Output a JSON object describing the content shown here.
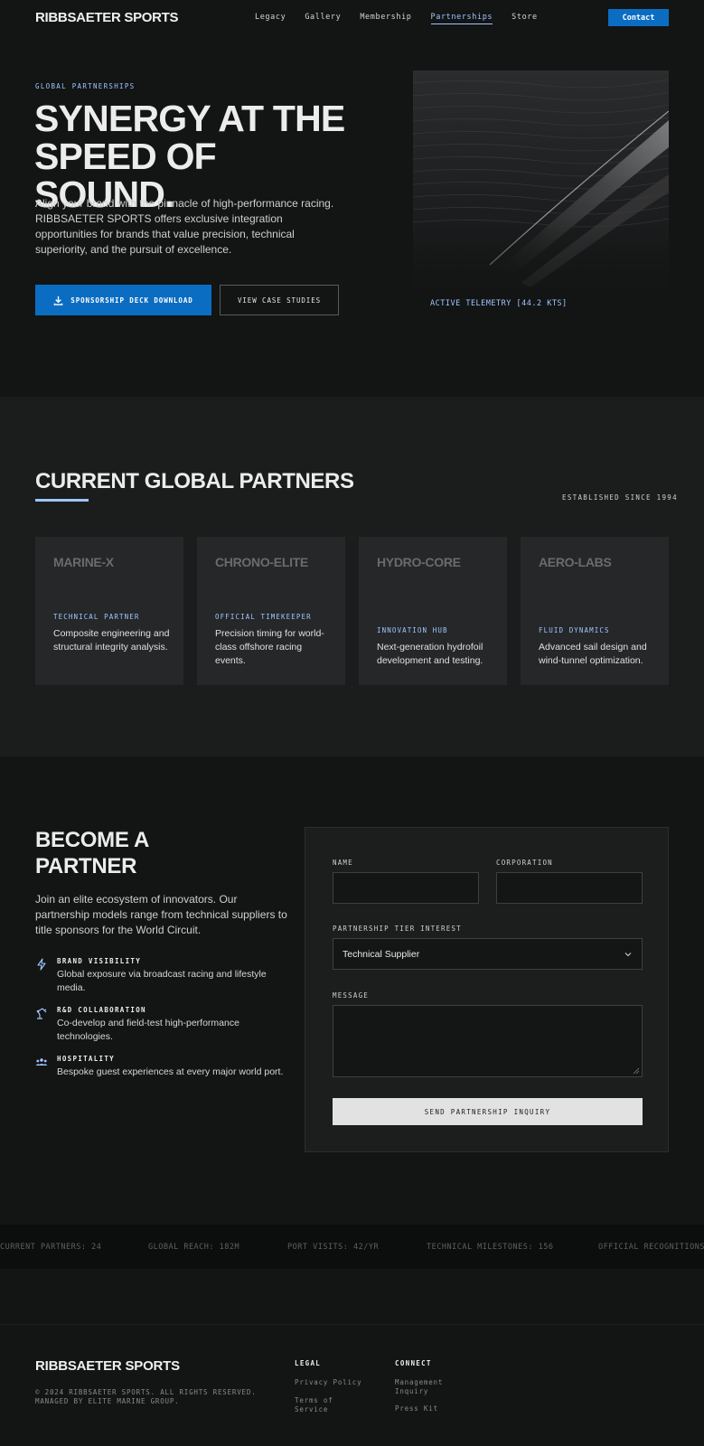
{
  "brand": "RIBBSAETER SPORTS",
  "nav": {
    "links": [
      "Legacy",
      "Gallery",
      "Membership",
      "Partnerships",
      "Store"
    ],
    "contact": "Contact"
  },
  "hero": {
    "eyebrow": "GLOBAL PARTNERSHIPS",
    "title": "SYNERGY AT THE SPEED OF SOUND.",
    "description": "Align your brand with the pinnacle of high-performance racing. RIBBSAETER SPORTS offers exclusive integration opportunities for brands that value precision, technical superiority, and the pursuit of excellence.",
    "primary_button": "SPONSORSHIP DECK DOWNLOAD",
    "secondary_button": "VIEW CASE STUDIES",
    "telemetry": "ACTIVE TELEMETRY [44.2 KTS]"
  },
  "partners": {
    "title": "CURRENT GLOBAL PARTNERS",
    "established": "ESTABLISHED SINCE 1994",
    "cards": [
      {
        "name": "MARINE-X",
        "role": "TECHNICAL PARTNER",
        "desc": "Composite engineering and structural integrity analysis."
      },
      {
        "name": "CHRONO-ELITE",
        "role": "OFFICIAL TIMEKEEPER",
        "desc": "Precision timing for world-class offshore racing events."
      },
      {
        "name": "HYDRO-CORE",
        "role": "INNOVATION HUB",
        "desc": "Next-generation hydrofoil development and testing."
      },
      {
        "name": "AERO-LABS",
        "role": "FLUID DYNAMICS",
        "desc": "Advanced sail design and wind-tunnel optimization."
      }
    ]
  },
  "become": {
    "title": "BECOME A PARTNER",
    "description": "Join an elite ecosystem of innovators. Our partnership models range from technical suppliers to title sponsors for the World Circuit.",
    "benefits": [
      {
        "icon": "lightning-icon",
        "title": "BRAND VISIBILITY",
        "desc": "Global exposure via broadcast racing and lifestyle media."
      },
      {
        "icon": "robot-arm-icon",
        "title": "R&D COLLABORATION",
        "desc": "Co-develop and field-test high-performance technologies."
      },
      {
        "icon": "group-icon",
        "title": "HOSPITALITY",
        "desc": "Bespoke guest experiences at every major world port."
      }
    ]
  },
  "form": {
    "name_label": "NAME",
    "name_value": "",
    "corporation_label": "CORPORATION",
    "corporation_value": "",
    "tier_label": "PARTNERSHIP TIER INTEREST",
    "tier_selected": "Technical Supplier",
    "message_label": "MESSAGE",
    "message_value": "",
    "submit": "SEND PARTNERSHIP INQUIRY"
  },
  "stats": [
    "CURRENT PARTNERS: 24",
    "GLOBAL REACH: 182M",
    "PORT VISITS: 42/YR",
    "TECHNICAL MILESTONES: 156",
    "OFFICIAL RECOGNITIONS:"
  ],
  "footer": {
    "brand": "RIBBSAETER SPORTS",
    "copyright": "© 2024 RIBBSAETER SPORTS. ALL RIGHTS RESERVED. MANAGED BY ELITE MARINE GROUP.",
    "legal_heading": "LEGAL",
    "legal_links": [
      "Privacy Policy",
      "Terms of Service"
    ],
    "connect_heading": "CONNECT",
    "connect_links": [
      "Management Inquiry",
      "Press Kit"
    ]
  },
  "colors": {
    "accent": "#0b6dc2",
    "highlight": "#9ec6ff",
    "background": "#131414",
    "panel": "#1b1c1c",
    "card": "#262729"
  }
}
